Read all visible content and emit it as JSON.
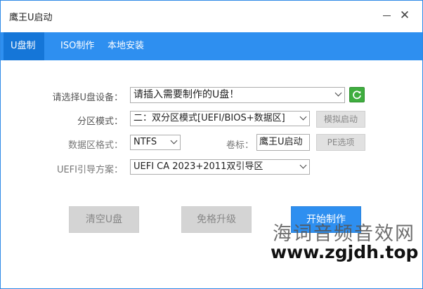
{
  "window": {
    "title": "鹰王U启动"
  },
  "tabs": [
    {
      "label": "U盘制作"
    },
    {
      "label": "ISO制作"
    },
    {
      "label": "本地安装"
    }
  ],
  "form": {
    "device_label": "请选择U盘设备：",
    "device_value": "请插入需要制作的U盘！",
    "partition_label": "分区模式：",
    "partition_value": "二：双分区模式[UEFI/BIOS+数据区]",
    "simulate_button": "模拟启动",
    "format_label": "数据区格式：",
    "format_value": "NTFS",
    "volume_label": "卷标：",
    "volume_value": "鹰王U启动",
    "pe_button": "PE选项",
    "uefi_label": "UEFI引导方案：",
    "uefi_value": "UEFI CA 2023+2011双引导区"
  },
  "actions": {
    "clear_button": "清空U盘",
    "upgrade_button": "免格升级",
    "start_button": "开始制作"
  },
  "watermark": {
    "line1": "海词音频音效网",
    "line2": "www.zgjdh.top"
  },
  "colors": {
    "accent": "#2e8ff0",
    "active_tab": "#1576d8",
    "refresh": "#3fae3f"
  }
}
